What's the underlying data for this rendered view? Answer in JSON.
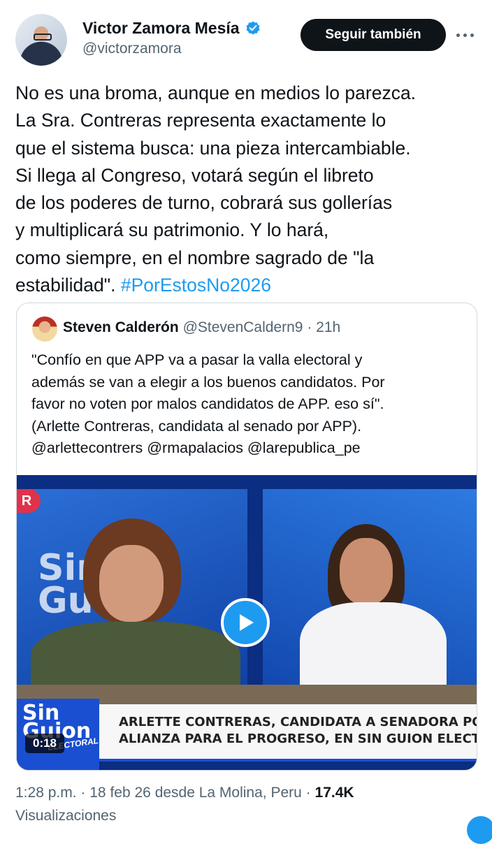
{
  "author": {
    "display_name": "Victor Zamora Mesía",
    "handle": "@victorzamora",
    "verified": true,
    "follow_label": "Seguir también"
  },
  "tweet": {
    "lines": [
      "No es una broma, aunque en medios lo parezca.",
      "La Sra. Contreras representa exactamente lo",
      "que el sistema busca: una pieza intercambiable.",
      "Si llega al Congreso, votará según el libreto",
      "de los poderes de turno, cobrará sus gollerías",
      "y multiplicará su patrimonio. Y lo hará,",
      "como siempre, en el nombre sagrado de \"la"
    ],
    "last_line_text": "estabilidad\".",
    "hashtag": "#PorEstosNo2026"
  },
  "quote": {
    "display_name": "Steven Calderón",
    "handle": "@StevenCaldern9",
    "separator": "·",
    "time": "21h",
    "lines": [
      "\"Confío en que APP va a pasar la valla electoral y",
      "además se van a elegir a los buenos candidatos. Por",
      "favor no voten por malos candidatos de APP. eso sí\".",
      "(Arlette Contreras, candidata al senado por APP).",
      "@arlettecontrers @rmapalacios @larepublica_pe"
    ],
    "video": {
      "duration": "0:18",
      "badge": "R",
      "bg_logo_text": "Sin Guion",
      "logo_top": "Sin Guion",
      "logo_sub": "ELECTORAL",
      "banner_line1": "ARLETTE CONTRERAS, CANDIDATA A SENADORA POR",
      "banner_line2": "ALIANZA PARA EL PROGRESO, EN SIN GUION ELECTORAL"
    }
  },
  "meta": {
    "time": "1:28 p.m.",
    "date": "18 feb 26",
    "location_text": "desde La Molina, Peru",
    "views_count": "17.4K",
    "views_label": "Visualizaciones",
    "separator": "·"
  },
  "colors": {
    "accent": "#1d9bf0",
    "text": "#0f1419",
    "secondary": "#536471",
    "border": "#cfd9de"
  },
  "icons": {
    "verified": "verified-badge-icon",
    "more": "more-horizontal-icon",
    "play": "play-icon",
    "compose": "compose-icon"
  }
}
